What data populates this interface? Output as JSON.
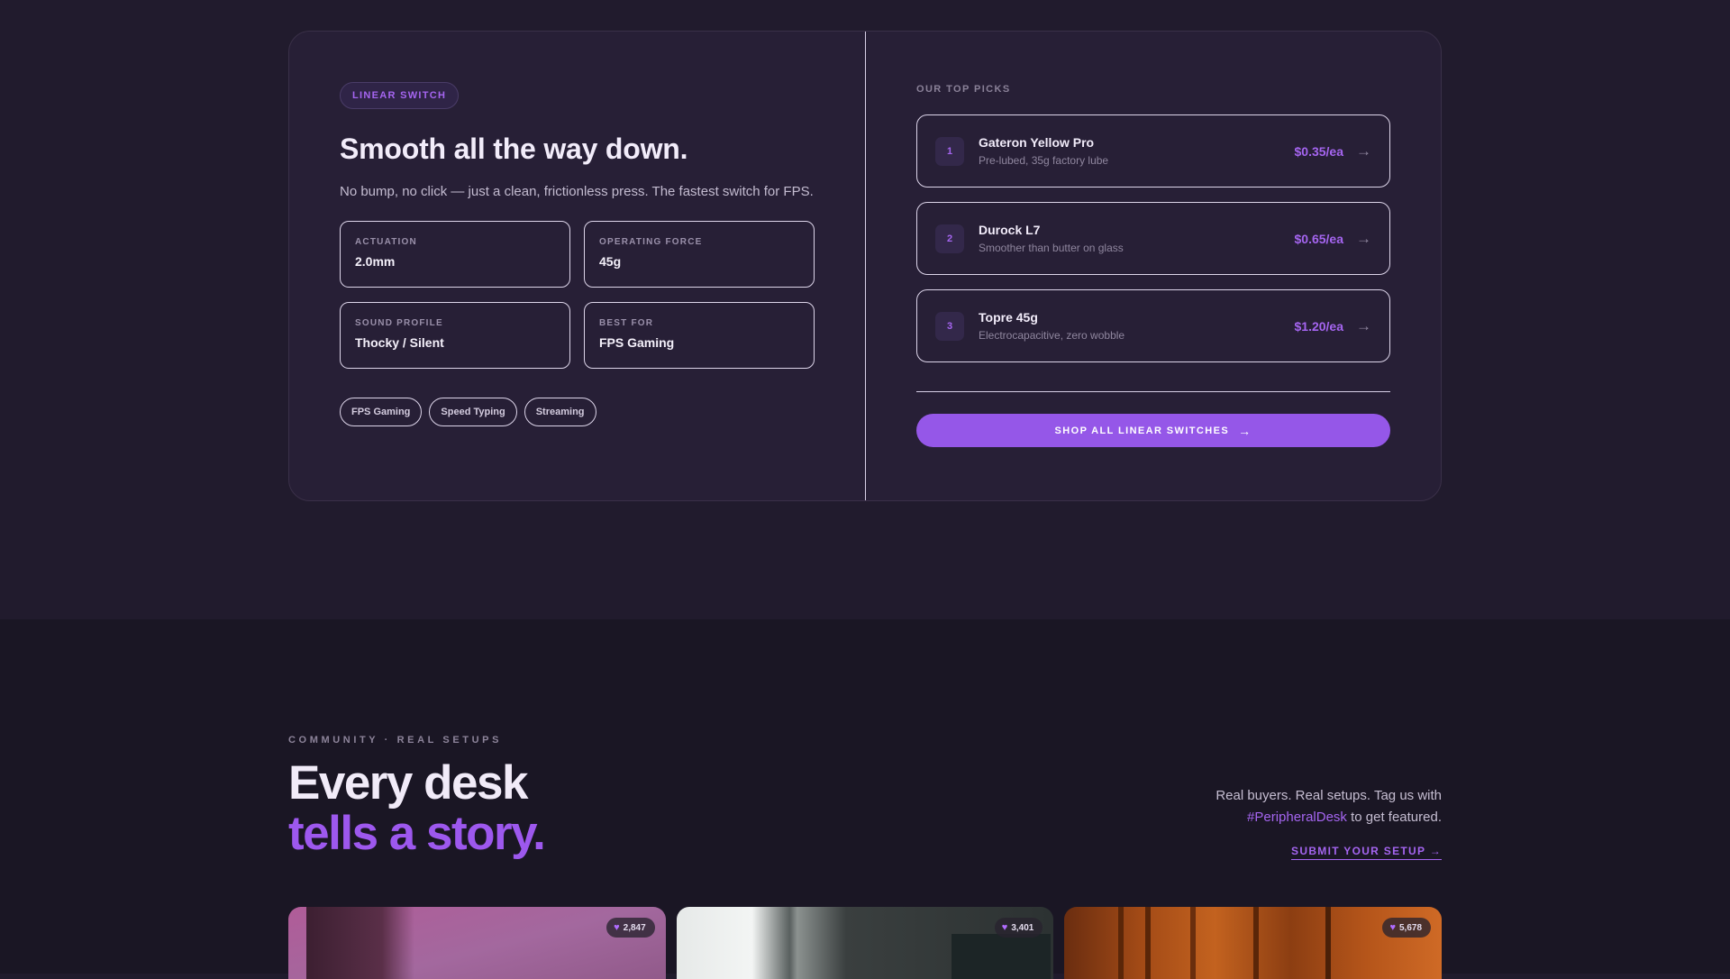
{
  "switch_card": {
    "badge": "LINEAR SWITCH",
    "headline": "Smooth all the way down.",
    "subtitle": "No bump, no click — just a clean, frictionless press. The fastest switch for FPS.",
    "specs": [
      {
        "label": "ACTUATION",
        "value": "2.0mm"
      },
      {
        "label": "OPERATING FORCE",
        "value": "45g"
      },
      {
        "label": "SOUND PROFILE",
        "value": "Thocky / Silent"
      },
      {
        "label": "BEST FOR",
        "value": "FPS Gaming"
      }
    ],
    "tags": [
      "FPS Gaming",
      "Speed Typing",
      "Streaming"
    ],
    "picks_heading": "OUR TOP PICKS",
    "picks": [
      {
        "rank": "1",
        "name": "Gateron Yellow Pro",
        "desc": "Pre-lubed, 35g factory lube",
        "price": "$0.35/ea"
      },
      {
        "rank": "2",
        "name": "Durock L7",
        "desc": "Smoother than butter on glass",
        "price": "$0.65/ea"
      },
      {
        "rank": "3",
        "name": "Topre 45g",
        "desc": "Electrocapacitive, zero wobble",
        "price": "$1.20/ea"
      }
    ],
    "arrow_glyph": "→",
    "shop_button": "SHOP ALL LINEAR SWITCHES"
  },
  "community": {
    "eyebrow": "COMMUNITY · REAL SETUPS",
    "title_line1": "Every desk",
    "title_line2": "tells a story.",
    "side_text_pre": "Real buyers. Real setups. Tag us with",
    "hashtag": "#PeripheralDesk",
    "side_text_post": "to get featured.",
    "submit_link": "SUBMIT YOUR SETUP →",
    "setups": [
      {
        "likes": "2,847",
        "icon": "heart-icon"
      },
      {
        "likes": "3,401",
        "icon": "heart-icon"
      },
      {
        "likes": "5,678",
        "icon": "heart-icon"
      }
    ]
  },
  "colors": {
    "accent": "#9557e8",
    "accent_text": "#a565f0",
    "background": "#211b2d",
    "card": "#271f36"
  }
}
